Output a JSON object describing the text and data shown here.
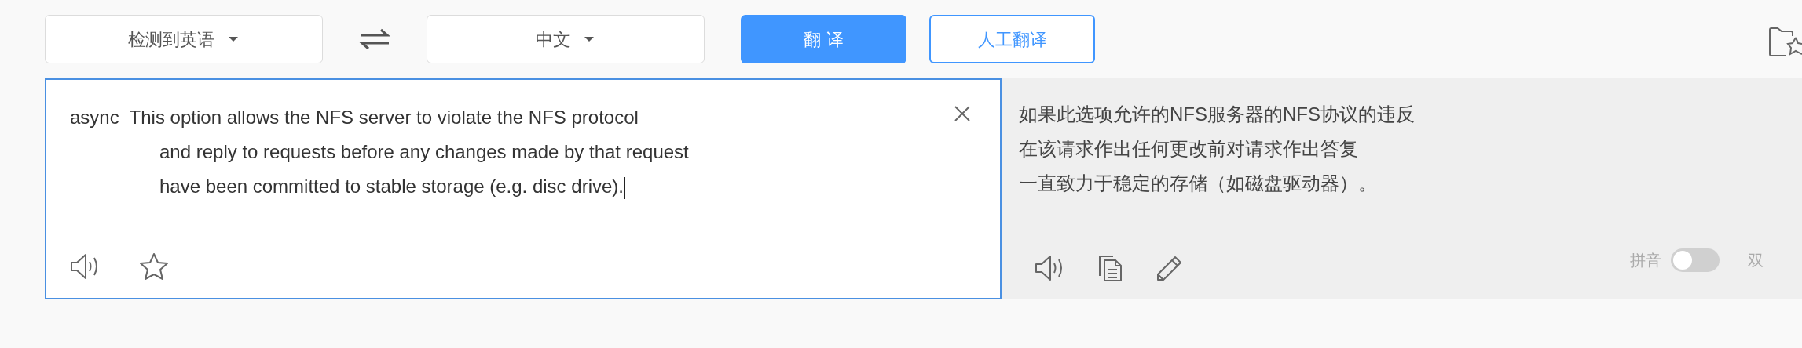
{
  "toolbar": {
    "source_language": "检测到英语",
    "target_language": "中文",
    "translate_button": "翻 译",
    "human_button": "人工翻译"
  },
  "source": {
    "lines": [
      "async  This option allows the NFS server to violate the NFS protocol",
      "and reply to requests before any changes made by that request",
      "have been committed to stable storage (e.g. disc drive)."
    ]
  },
  "result": {
    "lines": [
      "如果此选项允许的NFS服务器的NFS协议的违反",
      "在该请求作出任何更改前对请求作出答复",
      "一直致力于稳定的存储（如磁盘驱动器）。"
    ],
    "pinyin": {
      "label": "拼音",
      "on": false
    },
    "bilingual_label": "双"
  }
}
